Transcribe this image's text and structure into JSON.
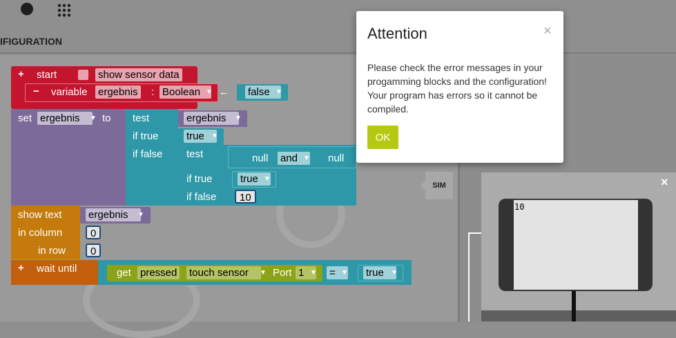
{
  "header": {
    "config_tab": "IFIGURATION",
    "globe_icon": "globe-icon",
    "apps_icon": "grid-icon"
  },
  "colors": {
    "start_red": "#c5142e",
    "var_purple": "#7c6a9a",
    "logic_teal": "#2e98a8",
    "text_orange": "#c57a0d",
    "wait_orange": "#c35e0c",
    "sensor_olive": "#8aa318",
    "modal_ok": "#b5c912"
  },
  "blocks": {
    "start": {
      "plus": "+",
      "label": "start",
      "show_sensor_data": "show sensor data"
    },
    "variable": {
      "minus": "−",
      "label": "variable",
      "name": "ergebnis",
      "colon": ":",
      "type": "Boolean",
      "arrow": "←",
      "value": "false"
    },
    "set": {
      "label": "set",
      "var": "ergebnis",
      "to": "to",
      "test_label": "test",
      "test_value": "ergebnis",
      "if_true_label": "if true",
      "if_true_value": "true",
      "if_false_label": "if false",
      "inner_test_label": "test",
      "null1": "null",
      "op": "and",
      "null2": "null",
      "inner_if_true_label": "if true",
      "inner_if_true_value": "true",
      "inner_if_false_label": "if false",
      "inner_if_false_value": "10"
    },
    "show_text": {
      "label": "show text",
      "value": "ergebnis",
      "col_label": "in column",
      "col_value": "0",
      "row_label": "in row",
      "row_value": "0"
    },
    "wait": {
      "plus": "+",
      "label": "wait until",
      "get": "get",
      "mode": "pressed",
      "sensor": "touch sensor",
      "port_label": "Port",
      "port_value": "1",
      "op": "=",
      "value": "true"
    }
  },
  "modal": {
    "title": "Attention",
    "close": "×",
    "message": "Please check the error messages in your progamming blocks and the configuration! Your program has errors so it cannot be compiled.",
    "ok": "OK"
  },
  "sim": {
    "button": "SIM",
    "close": "×",
    "screen_text": "10"
  }
}
